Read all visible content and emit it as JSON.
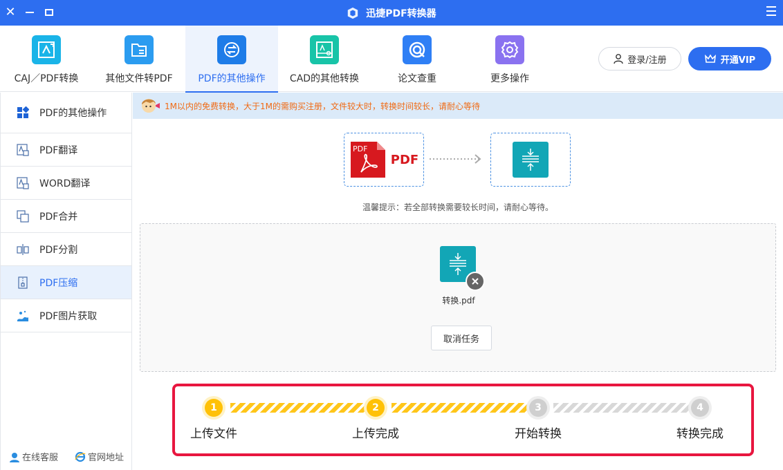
{
  "app": {
    "title": "迅捷PDF转换器",
    "accent": "#2d6ef0"
  },
  "toolbar": {
    "items": [
      {
        "label": "CAJ／PDF转换",
        "icon": "caj-pdf-icon",
        "color": "#1ab4e8"
      },
      {
        "label": "其他文件转PDF",
        "icon": "folder-icon",
        "color": "#2b9cf0"
      },
      {
        "label": "PDF的其他操作",
        "icon": "swap-icon",
        "color": "#1e7ce8",
        "active": true
      },
      {
        "label": "CAD的其他转换",
        "icon": "cad-icon",
        "color": "#18c4a8"
      },
      {
        "label": "论文查重",
        "icon": "search-check-icon",
        "color": "#2f7ff5"
      },
      {
        "label": "更多操作",
        "icon": "gear-icon",
        "color": "#8a72f0"
      }
    ],
    "login_label": "登录/注册",
    "vip_label": "开通VIP"
  },
  "sidebar": {
    "header": "PDF的其他操作",
    "items": [
      {
        "label": "PDF翻译",
        "icon": "translate-icon"
      },
      {
        "label": "WORD翻译",
        "icon": "translate-icon"
      },
      {
        "label": "PDF合并",
        "icon": "merge-icon"
      },
      {
        "label": "PDF分割",
        "icon": "split-icon"
      },
      {
        "label": "PDF压缩",
        "icon": "compress-icon",
        "active": true
      },
      {
        "label": "PDF图片获取",
        "icon": "image-extract-icon"
      }
    ],
    "footer": {
      "service_label": "在线客服",
      "website_label": "官网地址"
    }
  },
  "main": {
    "notice": "1M以内的免费转换，大于1M的需购买注册，文件较大时，转换时间较长，请耐心等待",
    "flow": {
      "source_badge": "PDF",
      "source_label": "PDF"
    },
    "hint": "温馨提示：若全部转换需要较长时间，请耐心等待。",
    "file": {
      "name": "转换.pdf"
    },
    "cancel_label": "取消任务"
  },
  "progress": {
    "steps": [
      {
        "num": "1",
        "label": "上传文件",
        "done": true
      },
      {
        "num": "2",
        "label": "上传完成",
        "done": true
      },
      {
        "num": "3",
        "label": "开始转换",
        "done": false
      },
      {
        "num": "4",
        "label": "转换完成",
        "done": false
      }
    ]
  }
}
